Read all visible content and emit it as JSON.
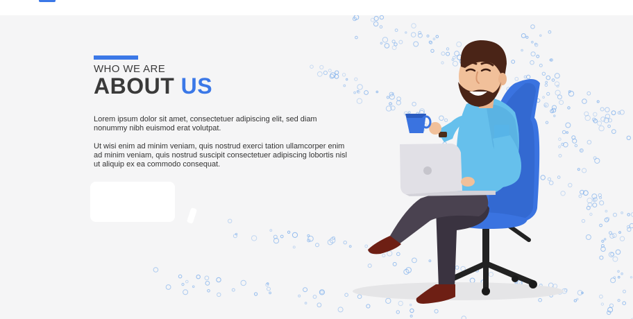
{
  "header": {
    "logo_icon": "logo-mark"
  },
  "about": {
    "eyebrow": "WHO WE ARE",
    "title_main": "ABOUT",
    "title_accent": "US",
    "paragraph_1": "Lorem ipsum dolor sit amet, consectetuer adipiscing elit, sed diam nonummy nibh euismod erat volutpat.",
    "paragraph_2": "Ut wisi enim ad minim veniam, quis nostrud exerci tation ullamcorper enim ad minim veniam, quis nostrud suscipit consectetuer adipiscing  lobortis nisl ut aliquip ex ea commodo consequat."
  },
  "illustration": {
    "icon": "man-with-laptop-illustration"
  },
  "colors": {
    "accent": "#3b78e7",
    "heading": "#3a3a3a",
    "background": "#f5f5f6",
    "chair": "#3a73e0",
    "shirt": "#66c0ec"
  }
}
